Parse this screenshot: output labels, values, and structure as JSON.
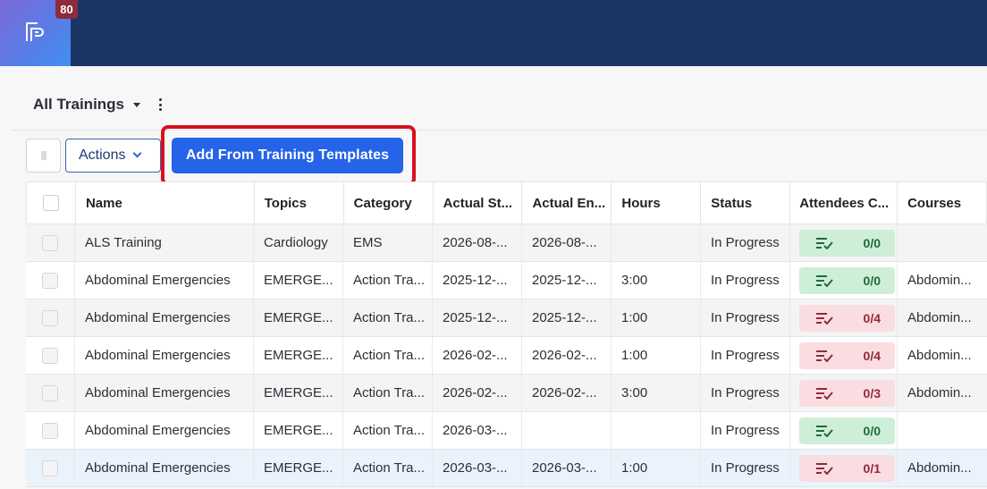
{
  "app": {
    "notification_count": "80"
  },
  "view": {
    "title": "All Trainings"
  },
  "toolbar": {
    "actions_label": "Actions",
    "add_from_templates_label": "Add From Training Templates"
  },
  "colors": {
    "header_bg": "#1c3565",
    "primary": "#2563e8",
    "highlight": "#d7101f",
    "attendees_ok_bg": "#cfeed8",
    "attendees_warn_bg": "#f9dde1"
  },
  "table": {
    "columns": [
      "Name",
      "Topics",
      "Category",
      "Actual St...",
      "Actual En...",
      "Hours",
      "Status",
      "Attendees C...",
      "Courses"
    ],
    "rows": [
      {
        "name": "ALS Training",
        "topics": "Cardiology",
        "category": "EMS",
        "start": "2026-08-...",
        "end": "2026-08-...",
        "hours": "",
        "status": "In Progress",
        "attendees": "0/0",
        "attendees_state": "green",
        "courses": ""
      },
      {
        "name": "Abdominal Emergencies",
        "topics": "EMERGE...",
        "category": "Action Tra...",
        "start": "2025-12-...",
        "end": "2025-12-...",
        "hours": "3:00",
        "status": "In Progress",
        "attendees": "0/0",
        "attendees_state": "green",
        "courses": "Abdomin..."
      },
      {
        "name": "Abdominal Emergencies",
        "topics": "EMERGE...",
        "category": "Action Tra...",
        "start": "2025-12-...",
        "end": "2025-12-...",
        "hours": "1:00",
        "status": "In Progress",
        "attendees": "0/4",
        "attendees_state": "red",
        "courses": "Abdomin..."
      },
      {
        "name": "Abdominal Emergencies",
        "topics": "EMERGE...",
        "category": "Action Tra...",
        "start": "2026-02-...",
        "end": "2026-02-...",
        "hours": "1:00",
        "status": "In Progress",
        "attendees": "0/4",
        "attendees_state": "red",
        "courses": "Abdomin..."
      },
      {
        "name": "Abdominal Emergencies",
        "topics": "EMERGE...",
        "category": "Action Tra...",
        "start": "2026-02-...",
        "end": "2026-02-...",
        "hours": "3:00",
        "status": "In Progress",
        "attendees": "0/3",
        "attendees_state": "red",
        "courses": "Abdomin..."
      },
      {
        "name": "Abdominal Emergencies",
        "topics": "EMERGE...",
        "category": "Action Tra...",
        "start": "2026-03-...",
        "end": "",
        "hours": "",
        "status": "In Progress",
        "attendees": "0/0",
        "attendees_state": "green",
        "courses": ""
      },
      {
        "name": "Abdominal Emergencies",
        "topics": "EMERGE...",
        "category": "Action Tra...",
        "start": "2026-03-...",
        "end": "2026-03-...",
        "hours": "1:00",
        "status": "In Progress",
        "attendees": "0/1",
        "attendees_state": "red",
        "courses": "Abdomin..."
      }
    ]
  }
}
